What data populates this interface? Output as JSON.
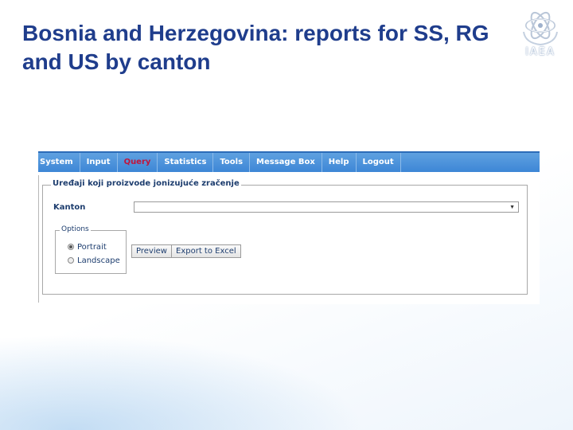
{
  "slide": {
    "title": "Bosnia and Herzegovina: reports for SS, RG and US by canton",
    "logo_text": "IAEA"
  },
  "menu": {
    "items": [
      {
        "label": "y System",
        "active": false
      },
      {
        "label": "Input",
        "active": false
      },
      {
        "label": "Query",
        "active": true
      },
      {
        "label": "Statistics",
        "active": false
      },
      {
        "label": "Tools",
        "active": false
      },
      {
        "label": "Message Box",
        "active": false
      },
      {
        "label": "Help",
        "active": false
      },
      {
        "label": "Logout",
        "active": false
      }
    ]
  },
  "form": {
    "legend": "Uređaji koji proizvode jonizujuće zračenje",
    "kanton_label": "Kanton",
    "kanton_value": "",
    "options_legend": "Options",
    "portrait_label": "Portrait",
    "landscape_label": "Landscape",
    "orientation_selected": "Portrait",
    "preview_label": "Preview",
    "export_label": "Export to Excel"
  },
  "colors": {
    "title": "#1f3d8c",
    "menubar": "#3d86d6",
    "active_menu": "#c0143c",
    "form_text": "#1d3d6e"
  }
}
